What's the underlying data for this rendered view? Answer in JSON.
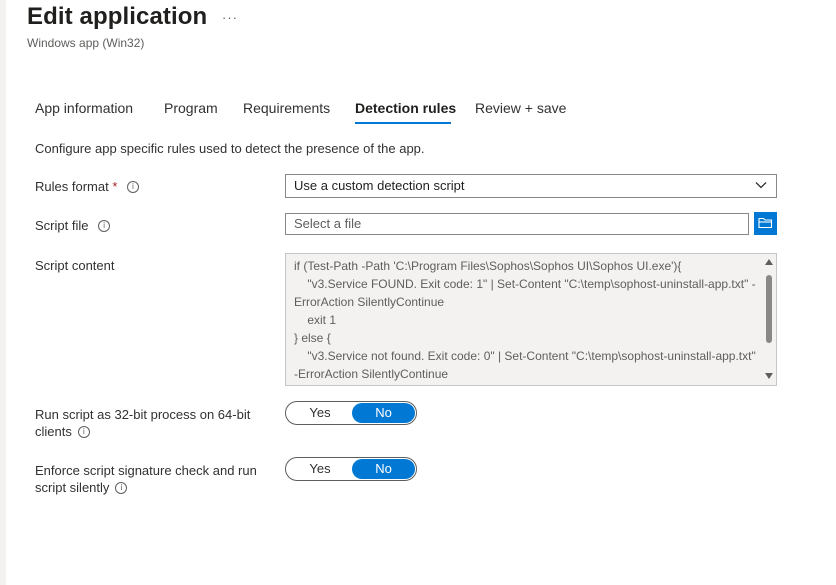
{
  "header": {
    "title": "Edit application",
    "more": "···",
    "subtitle": "Windows app (Win32)"
  },
  "tabs": [
    {
      "label": "App information",
      "active": false
    },
    {
      "label": "Program",
      "active": false
    },
    {
      "label": "Requirements",
      "active": false
    },
    {
      "label": "Detection rules",
      "active": true
    },
    {
      "label": "Review + save",
      "active": false
    }
  ],
  "intro": "Configure app specific rules used to detect the presence of the app.",
  "form": {
    "rules_format": {
      "label": "Rules format",
      "required_mark": "*",
      "value": "Use a custom detection script"
    },
    "script_file": {
      "label": "Script file",
      "placeholder": "Select a file"
    },
    "script_content": {
      "label": "Script content",
      "value": "if (Test-Path -Path 'C:\\Program Files\\Sophos\\Sophos UI\\Sophos UI.exe'){\n    \"v3.Service FOUND. Exit code: 1\" | Set-Content \"C:\\temp\\sophost-uninstall-app.txt\" -ErrorAction SilentlyContinue\n    exit 1\n} else {\n    \"v3.Service not found. Exit code: 0\" | Set-Content \"C:\\temp\\sophost-uninstall-app.txt\" -ErrorAction SilentlyContinue"
    },
    "run_32bit": {
      "label_line1": "Run script as 32-bit process on 64-bit",
      "label_line2": "clients",
      "yes": "Yes",
      "no": "No",
      "selected": "No"
    },
    "enforce_signature": {
      "label_line1": "Enforce script signature check and run",
      "label_line2": "script silently",
      "yes": "Yes",
      "no": "No",
      "selected": "No"
    }
  },
  "icons": {
    "info": "info-icon",
    "chevron": "chevron-down-icon",
    "folder": "folder-open-icon"
  },
  "colors": {
    "accent": "#0078d4",
    "required": "#a4262c"
  }
}
